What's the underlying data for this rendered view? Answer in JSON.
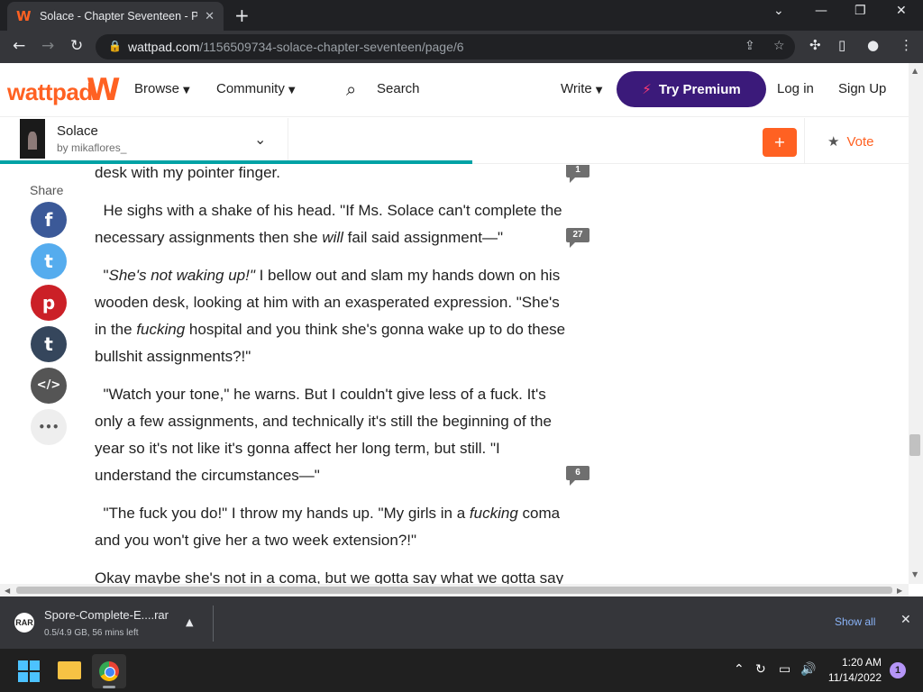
{
  "browser": {
    "tab_title": "Solace - Chapter Seventeen - Pag",
    "tab_close": "✕",
    "new_tab": "+",
    "url_domain": "wattpad.com",
    "url_path": "/1156509734-solace-chapter-seventeen/page/6"
  },
  "header": {
    "logo": "wattpad",
    "browse": "Browse",
    "community": "Community",
    "search": "Search",
    "write": "Write",
    "premium": "Try Premium",
    "login": "Log in",
    "signup": "Sign Up",
    "brand_color": "#ff6122",
    "premium_color": "#3b1a7a"
  },
  "storybar": {
    "title": "Solace",
    "author": "by mikaflores_",
    "add_label": "+",
    "vote": "Vote",
    "progress_fraction": 0.52
  },
  "share": {
    "label": "Share",
    "buttons": [
      {
        "icon": "facebook-icon",
        "glyph": "f",
        "color": "#3b5998"
      },
      {
        "icon": "twitter-icon",
        "glyph": "t",
        "color": "#55acee"
      },
      {
        "icon": "pinterest-icon",
        "glyph": "p",
        "color": "#cb2027"
      },
      {
        "icon": "tumblr-icon",
        "glyph": "t",
        "color": "#35465c"
      },
      {
        "icon": "embed-icon",
        "glyph": "</>",
        "color": "#555555"
      },
      {
        "icon": "more-icon",
        "glyph": "•••",
        "color": "#eeeeee"
      }
    ]
  },
  "story": {
    "p0": "desk with my pointer finger.",
    "p1_a": "He sighs with a shake of his head. \"If Ms. Solace can't complete the necessary assignments then she ",
    "p1_em": "will",
    "p1_b": " fail said assignment—\"",
    "p2_q": "\"",
    "p2_em1": "She's not waking up!\"",
    "p2_a": " I bellow out and slam my hands down on his wooden desk, looking at him with an exasperated expression. \"She's in the ",
    "p2_em2": "fucking",
    "p2_b": " hospital and you think she's gonna wake up to do these bullshit assignments?!\"",
    "p3": "\"Watch your tone,\" he warns. But I couldn't give less of a fuck. It's only a few assignments, and technically it's still the beginning of the year so it's not like it's gonna affect her long term, but still. \"I understand the circumstances—\"",
    "p4_a": "\"The fuck you do!\" I throw my hands up. \"My girls in a ",
    "p4_em": "fucking",
    "p4_b": " coma and you won't give her a two week extension?!\"",
    "p5": "Okay maybe she's not in a coma, but we gotta say what we gotta say"
  },
  "comments": [
    "1",
    "27",
    "6"
  ],
  "downloads": {
    "file": "Spore-Complete-E....rar",
    "status": "0.5/4.9 GB, 56 mins left",
    "show_all": "Show all",
    "icon_text": "RAR"
  },
  "taskbar": {
    "time": "1:20 AM",
    "date": "11/14/2022",
    "notifications": "1"
  }
}
